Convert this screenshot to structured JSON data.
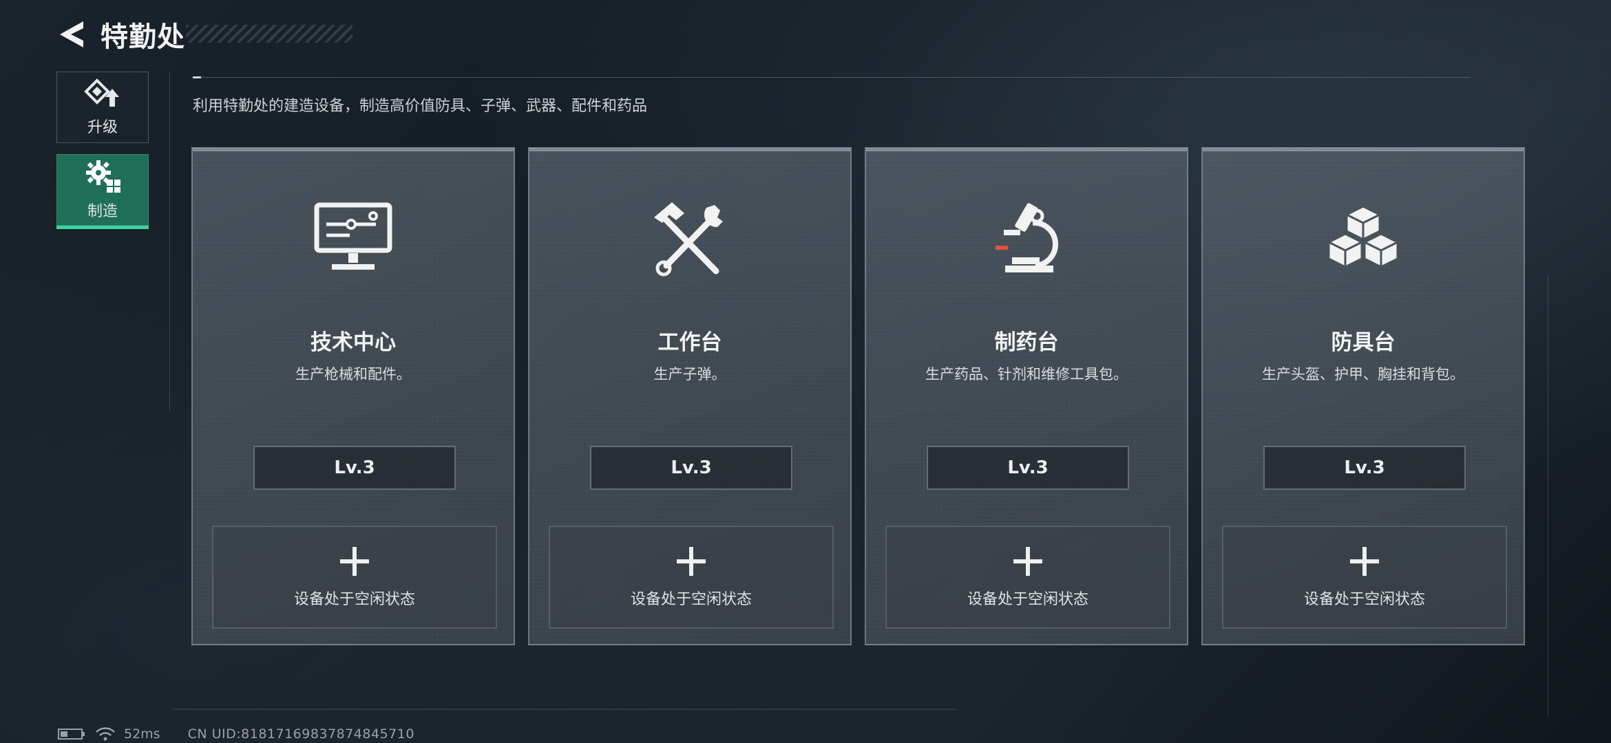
{
  "header": {
    "title": "特勤处"
  },
  "sidebar": {
    "items": [
      {
        "label": "升级",
        "icon": "upgrade-icon",
        "active": false
      },
      {
        "label": "制造",
        "icon": "gear-craft-icon",
        "active": true
      }
    ]
  },
  "main": {
    "subtitle": "利用特勤处的建造设备，制造高价值防具、子弹、武器、配件和药品",
    "cards": [
      {
        "name": "技术中心",
        "desc": "生产枪械和配件。",
        "level": "Lv.3",
        "status": "设备处于空闲状态",
        "icon": "monitor-icon"
      },
      {
        "name": "工作台",
        "desc": "生产子弹。",
        "level": "Lv.3",
        "status": "设备处于空闲状态",
        "icon": "hammer-wrench-icon"
      },
      {
        "name": "制药台",
        "desc": "生产药品、针剂和维修工具包。",
        "level": "Lv.3",
        "status": "设备处于空闲状态",
        "icon": "microscope-icon"
      },
      {
        "name": "防具台",
        "desc": "生产头盔、护甲、胸挂和背包。",
        "level": "Lv.3",
        "status": "设备处于空闲状态",
        "icon": "cubes-icon"
      }
    ]
  },
  "footer": {
    "latency": "52ms",
    "uid": "CN UID:818171698378748457​10"
  },
  "colors": {
    "accent": "#3fd39c",
    "active_bg": "#1f6e57"
  }
}
